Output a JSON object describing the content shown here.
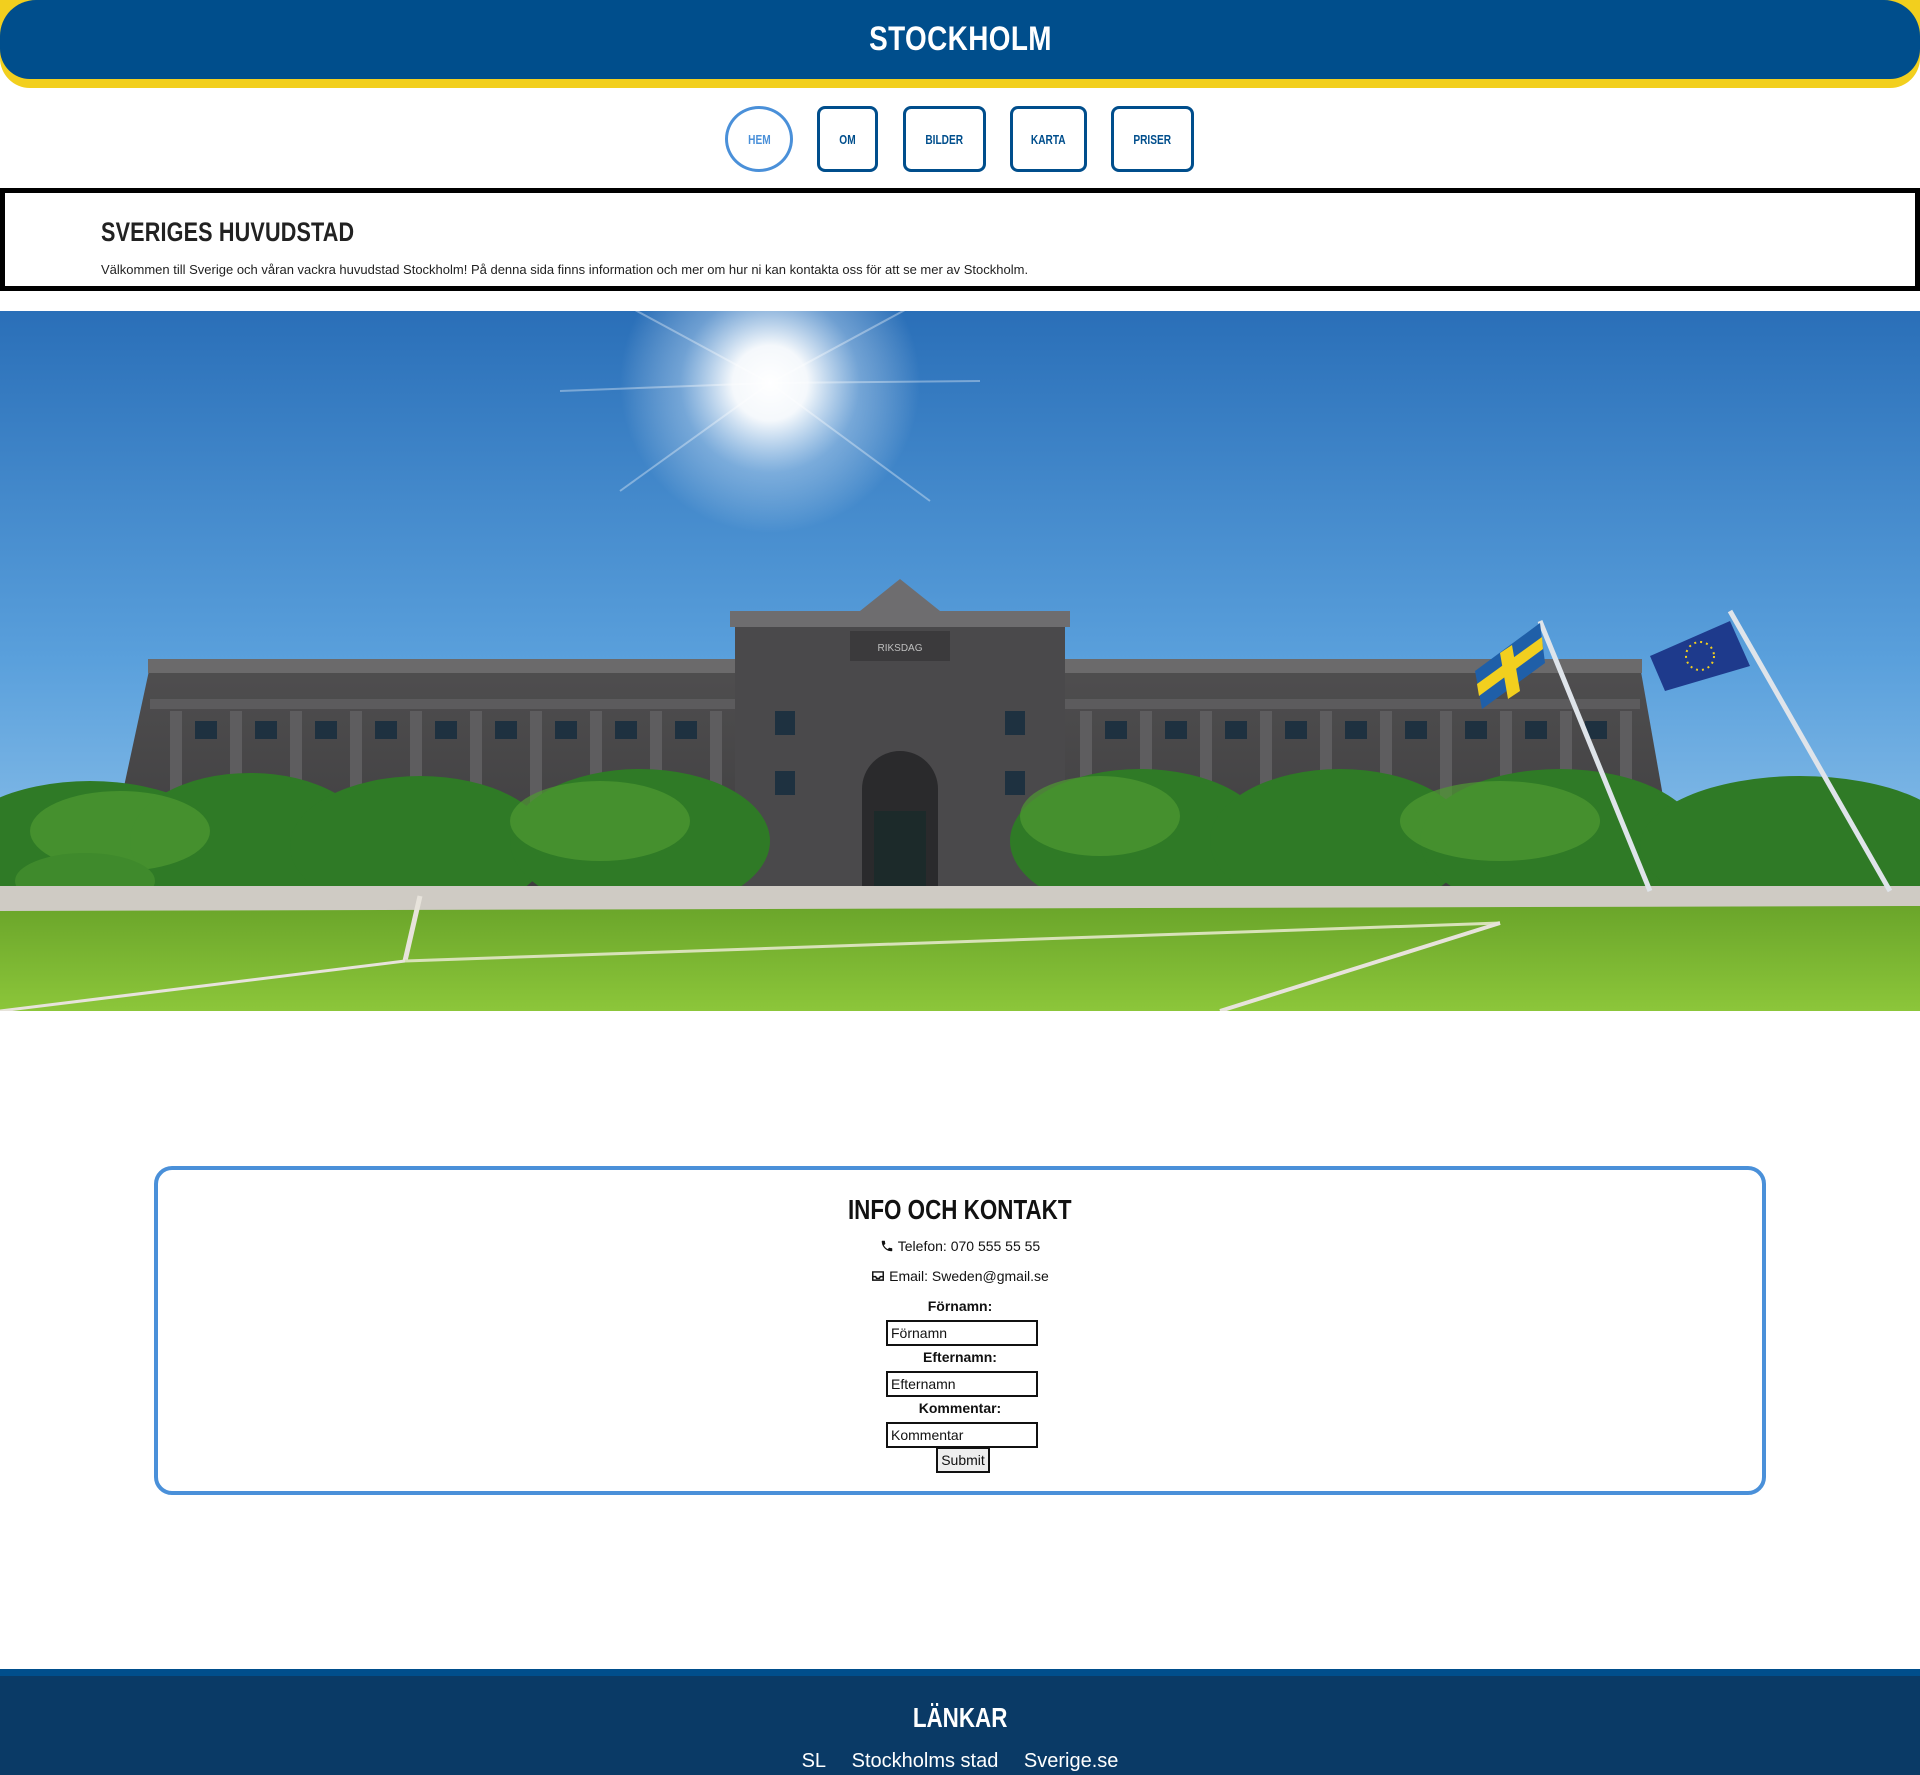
{
  "header": {
    "title": "STOCKHOLM"
  },
  "nav": {
    "items": [
      {
        "label": "HEM",
        "active": true
      },
      {
        "label": "OM"
      },
      {
        "label": "BILDER"
      },
      {
        "label": "KARTA"
      },
      {
        "label": "PRISER"
      }
    ]
  },
  "intro": {
    "heading": "SVERIGES HUVUDSTAD",
    "text": "Välkommen till Sverige och våran vackra huvudstad Stockholm! På denna sida finns information och mer om hur ni kan kontakta oss för att se mer av Stockholm."
  },
  "hero": {
    "facade_text": "RIKSDAG"
  },
  "contact": {
    "heading": "INFO OCH KONTAKT",
    "phone": "Telefon: 070 555 55 55",
    "email": "Email: Sweden@gmail.se",
    "form": {
      "firstname_label": "Förnamn:",
      "firstname_placeholder": "Förnamn",
      "lastname_label": "Efternamn:",
      "lastname_placeholder": "Efternamn",
      "comment_label": "Kommentar:",
      "comment_placeholder": "Kommentar",
      "submit_label": "Submit"
    }
  },
  "footer": {
    "heading": "LÄNKAR",
    "links": [
      "SL",
      "Stockholms stad",
      "Sverige.se"
    ]
  },
  "colors": {
    "header_blue": "#004e8c",
    "header_yellow": "#f2cf1e",
    "accent_blue": "#4a90d9",
    "footer_blue": "#0a3a66"
  }
}
